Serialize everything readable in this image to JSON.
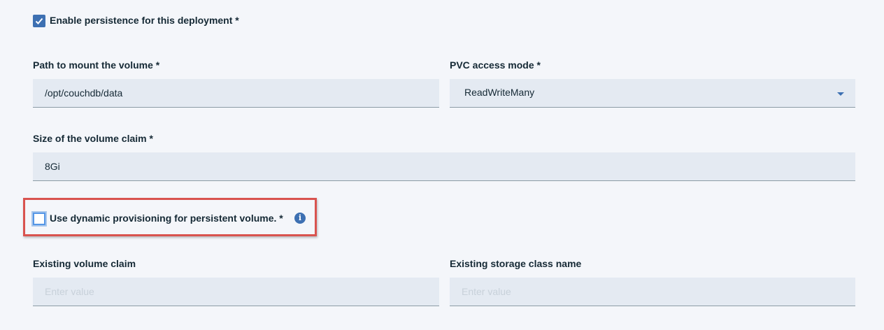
{
  "persistence": {
    "label": "Enable persistence for this deployment *",
    "checked": true
  },
  "mount_path": {
    "label": "Path to mount the volume *",
    "value": "/opt/couchdb/data"
  },
  "access_mode": {
    "label": "PVC access mode *",
    "value": "ReadWriteMany"
  },
  "claim_size": {
    "label": "Size of the volume claim *",
    "value": "8Gi"
  },
  "dynamic_provisioning": {
    "label": "Use dynamic provisioning for persistent volume. *",
    "checked": false,
    "info_icon": "info-icon",
    "highlight_color": "#d9534f"
  },
  "existing_claim": {
    "label": "Existing volume claim",
    "value": "",
    "placeholder": "Enter value"
  },
  "existing_storage_class": {
    "label": "Existing storage class name",
    "value": "",
    "placeholder": "Enter value"
  },
  "colors": {
    "background": "#f4f6fa",
    "accent": "#3d70b2",
    "input_fill": "#e4eaf2",
    "highlight": "#d9534f"
  }
}
